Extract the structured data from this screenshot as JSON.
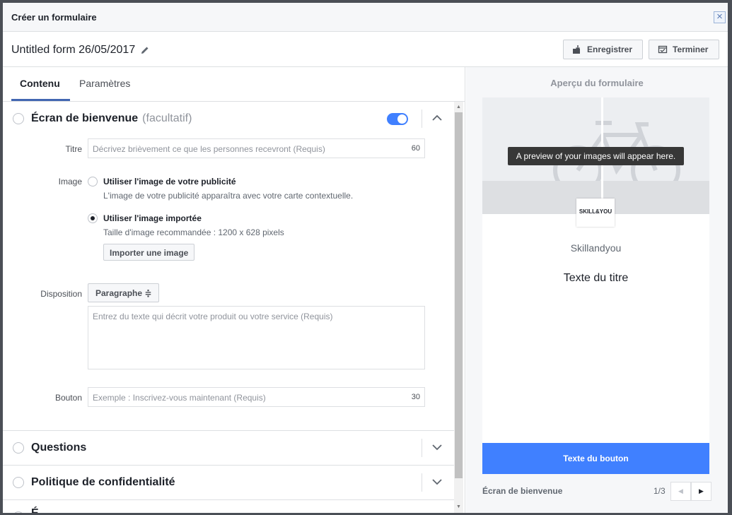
{
  "dialog": {
    "title": "Créer un formulaire"
  },
  "form_bar": {
    "form_name": "Untitled form 26/05/2017",
    "save_label": "Enregistrer",
    "done_label": "Terminer"
  },
  "tabs": [
    {
      "label": "Contenu",
      "active": true
    },
    {
      "label": "Paramètres",
      "active": false
    }
  ],
  "welcome": {
    "title": "Écran de bienvenue",
    "optional": "(facultatif)",
    "toggle_on": true,
    "titre_label": "Titre",
    "titre_placeholder": "Décrivez brièvement ce que les personnes recevront (Requis)",
    "titre_counter": "60",
    "image_label": "Image",
    "image_opt1_title": "Utiliser l'image de votre publicité",
    "image_opt1_sub": "L'image de votre publicité apparaîtra avec votre carte contextuelle.",
    "image_opt2_title": "Utiliser l'image importée",
    "image_opt2_sub": "Taille d'image recommandée : 1200 x 628 pixels",
    "import_label": "Importer une image",
    "disposition_label": "Disposition",
    "disposition_value": "Paragraphe ≑",
    "desc_placeholder": "Entrez du texte qui décrit votre produit ou votre service (Requis)",
    "bouton_label": "Bouton",
    "bouton_placeholder": "Exemple : Inscrivez-vous maintenant (Requis)",
    "bouton_counter": "30"
  },
  "sections": [
    {
      "title": "Questions"
    },
    {
      "title": "Politique de confidentialité"
    },
    {
      "title": "É"
    }
  ],
  "preview": {
    "title": "Aperçu du formulaire",
    "tooltip": "A preview of your images will appear here.",
    "logo_text": "SKILL&YOU",
    "brand": "Skillandyou",
    "headline": "Texte du titre",
    "cta": "Texte du bouton",
    "footer_label": "Écran de bienvenue",
    "pager": "1/3"
  },
  "colors": {
    "accent": "#4080ff",
    "tab_underline": "#4267b2"
  }
}
